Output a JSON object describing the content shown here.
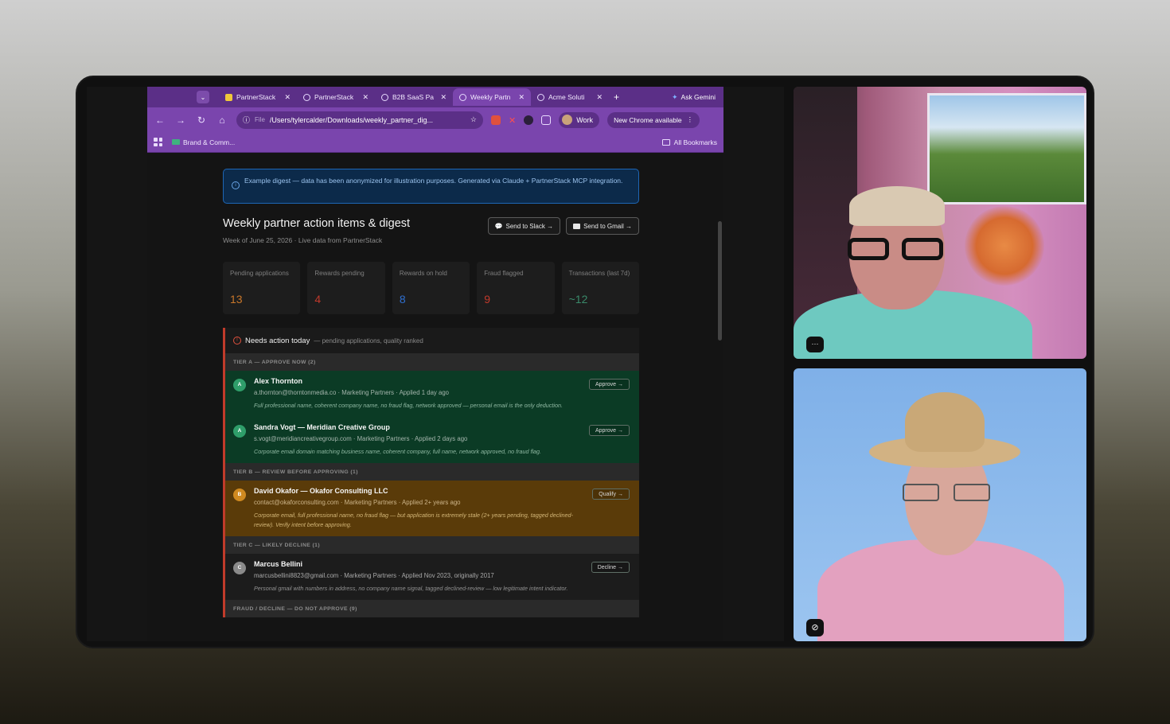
{
  "browser": {
    "tabs": [
      {
        "title": "PartnerStack",
        "active": false,
        "icon": "folder-icon"
      },
      {
        "title": "PartnerStack",
        "active": false,
        "icon": "globe-icon"
      },
      {
        "title": "B2B SaaS Pa",
        "active": false,
        "icon": "globe-icon"
      },
      {
        "title": "Weekly Partn",
        "active": true,
        "icon": "globe-icon"
      },
      {
        "title": "Acme Soluti",
        "active": false,
        "icon": "globe-icon"
      }
    ],
    "ask_gemini": "Ask Gemini",
    "address": {
      "scheme": "File",
      "url": "/Users/tylercalder/Downloads/weekly_partner_dig..."
    },
    "profile": "Work",
    "update": "New Chrome available",
    "bookmark": "Brand & Comm...",
    "all_bookmarks": "All Bookmarks"
  },
  "page": {
    "banner": "Example digest — data has been anonymized for illustration purposes. Generated via Claude + PartnerStack MCP integration.",
    "title": "Weekly partner action items & digest",
    "subtitle": "Week of June 25, 2026 · Live data from PartnerStack",
    "send_slack": "Send to Slack →",
    "send_gmail": "Send to Gmail →",
    "stats": [
      {
        "label": "Pending applications",
        "value": "13",
        "color": "#c9772a"
      },
      {
        "label": "Rewards pending",
        "value": "4",
        "color": "#c0392b"
      },
      {
        "label": "Rewards on hold",
        "value": "8",
        "color": "#2f6fd0"
      },
      {
        "label": "Fraud flagged",
        "value": "9",
        "color": "#c0392b"
      },
      {
        "label": "Transactions (last 7d)",
        "value": "~12",
        "color": "#3a8a6a"
      }
    ],
    "panel": {
      "title": "Needs action today",
      "note": "— pending applications, quality ranked",
      "tier_a": "TIER A — APPROVE NOW (2)",
      "tier_b": "TIER B — REVIEW BEFORE APPROVING (1)",
      "tier_c": "TIER C — LIKELY DECLINE (1)",
      "tier_fraud": "FRAUD / DECLINE — DO NOT APPROVE (9)",
      "rows": [
        {
          "badge": "A",
          "name": "Alex Thornton",
          "meta": "a.thornton@thorntonmedia.co · Marketing Partners · Applied 1 day ago",
          "desc": "Full professional name, coherent company name, no fraud flag, network approved — personal email is the only deduction.",
          "action": "Approve →"
        },
        {
          "badge": "A",
          "name": "Sandra Vogt — Meridian Creative Group",
          "meta": "s.vogt@meridiancreativegroup.com · Marketing Partners · Applied 2 days ago",
          "desc": "Corporate email domain matching business name, coherent company, full name, network approved, no fraud flag.",
          "action": "Approve →"
        },
        {
          "badge": "B",
          "name": "David Okafor — Okafor Consulting LLC",
          "meta": "contact@okaforconsulting.com · Marketing Partners · Applied 2+ years ago",
          "desc": "Corporate email, full professional name, no fraud flag — but application is extremely stale (2+ years pending, tagged declined-review). Verify intent before approving.",
          "action": "Qualify →"
        },
        {
          "badge": "C",
          "name": "Marcus Bellini",
          "meta": "marcusbellini8823@gmail.com · Marketing Partners · Applied Nov 2023, originally 2017",
          "desc": "Personal gmail with numbers in address, no company name signal, tagged declined-review — low legitimate intent indicator.",
          "action": "Decline →"
        }
      ]
    }
  },
  "video": {
    "options_label": "···"
  }
}
